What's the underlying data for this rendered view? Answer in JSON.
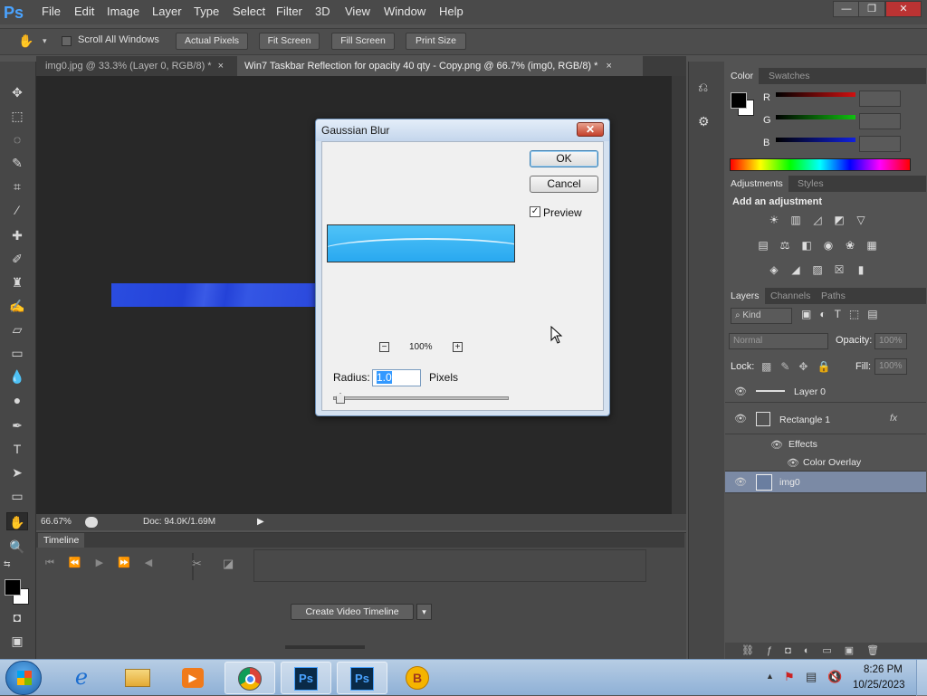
{
  "app": {
    "logo": "Ps"
  },
  "menu": [
    "File",
    "Edit",
    "Image",
    "Layer",
    "Type",
    "Select",
    "Filter",
    "3D",
    "View",
    "Window",
    "Help"
  ],
  "window_controls": {
    "minimize": "—",
    "restore": "❐",
    "close": "✕"
  },
  "options": {
    "scroll_all_windows": "Scroll All Windows",
    "actual_pixels": "Actual Pixels",
    "fit_screen": "Fit Screen",
    "fill_screen": "Fill Screen",
    "print_size": "Print Size"
  },
  "tabs": [
    {
      "label": "img0.jpg @ 33.3% (Layer 0, RGB/8) *",
      "close": "×"
    },
    {
      "label": "Win7 Taskbar Reflection for opacity 40 qty - Copy.png @ 66.7% (img0, RGB/8) *",
      "close": "×"
    }
  ],
  "status": {
    "zoom": "66.67%",
    "doc": "Doc: 94.0K/1.69M"
  },
  "timeline": {
    "title": "Timeline",
    "create_button": "Create Video Timeline"
  },
  "dialog": {
    "title": "Gaussian Blur",
    "ok": "OK",
    "cancel": "Cancel",
    "preview_label": "Preview",
    "preview_checked": "✓",
    "zoom": "100%",
    "minus": "−",
    "plus": "+",
    "radius_label": "Radius:",
    "radius_value": "1.0",
    "unit": "Pixels"
  },
  "color_panel": {
    "tabs": [
      "Color",
      "Swatches"
    ],
    "channels": [
      "R",
      "G",
      "B"
    ],
    "colors": {
      "r": "#d01010",
      "g": "#10c010",
      "b": "#1020e0"
    }
  },
  "adjustments": {
    "tabs": [
      "Adjustments",
      "Styles"
    ],
    "heading": "Add an adjustment"
  },
  "layers": {
    "tabs": [
      "Layers",
      "Channels",
      "Paths"
    ],
    "kind": "Kind",
    "blend_mode": "Normal",
    "opacity_label": "Opacity:",
    "opacity_value": "100%",
    "lock_label": "Lock:",
    "fill_label": "Fill:",
    "fill_value": "100%",
    "rows": [
      {
        "name": "Layer 0"
      },
      {
        "name": "Rectangle 1",
        "fx": "fx"
      },
      {
        "name": "Effects"
      },
      {
        "name": "Color Overlay"
      },
      {
        "name": "img0"
      }
    ]
  },
  "clock": {
    "time": "8:26 PM",
    "date": "10/25/2023"
  },
  "taskbar_apps": [
    "ie-icon",
    "explorer-icon",
    "media-icon",
    "chrome-icon",
    "photoshop-icon",
    "photoshop-icon",
    "bitcomet-icon"
  ]
}
